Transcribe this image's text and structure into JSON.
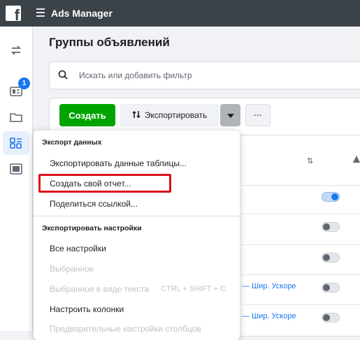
{
  "topbar": {
    "logo_letter": "f",
    "app_title": "Ads Manager"
  },
  "sidebar": {
    "icons": [
      "switch-arrows-icon",
      "ads-list-icon",
      "folder-icon",
      "grid-icon",
      "image-icon"
    ],
    "badge_count": "1",
    "accent": "#1877f2"
  },
  "main": {
    "page_title": "Группы объявлений",
    "search_placeholder": "Искать или добавить фильтр"
  },
  "toolbar": {
    "create_label": "Создать",
    "export_label": "Экспортировать",
    "more_label": "···",
    "create_color": "#00a400"
  },
  "dropdown": {
    "section_export_data": "Экспорт данных",
    "export_table": "Экспортировать данные таблицы...",
    "create_report": "Создать свой отчет...",
    "share_link": "Поделиться ссылкой...",
    "section_export_settings": "Экспортировать настройки",
    "all_settings": "Все настройки",
    "selected": "Выбранное",
    "selected_text": "Выбранное в виде текста",
    "selected_text_shortcut": "CTRL + SHIFT + C",
    "configure_columns": "Настроить колонки",
    "column_presets": "Предварительные настройки столбцов",
    "highlight_color": "#d9131d"
  },
  "table": {
    "rows": [
      {
        "toggle": "on",
        "text": ""
      },
      {
        "toggle": "off",
        "text": ""
      },
      {
        "toggle": "off",
        "text": ""
      },
      {
        "toggle": "off",
        "text": "— Шир. Ускоре"
      },
      {
        "toggle": "off",
        "text": "— Шир. Ускоре"
      }
    ]
  }
}
